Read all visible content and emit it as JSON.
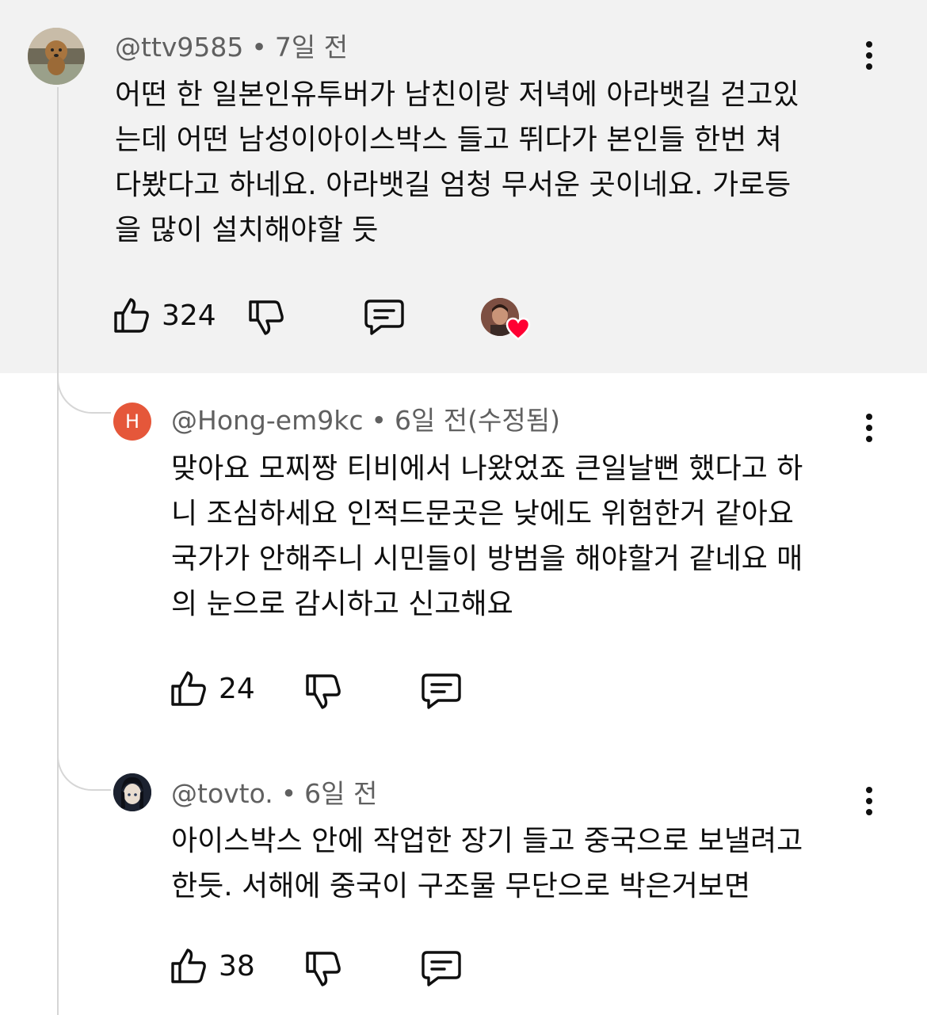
{
  "comments": [
    {
      "handle": "@ttv9585",
      "time": "7일 전",
      "text": "어떤 한 일본인유투버가 남친이랑 저녁에 아라뱃길 걷고있\n는데 어떤 남성이아이스박스 들고 뛰다가 본인들 한번 쳐\n다봤다고 하네요.  아라뱃길 엄청 무서운 곳이네요. 가로등\n을 많이 설치해야할 듯",
      "likes": "324",
      "avatar_icon": "dog-photo-avatar",
      "creator_heart_icon": "heart-icon"
    },
    {
      "handle": "@Hong-em9kc",
      "time": "6일 전(수정됨)",
      "text": "맞아요 모찌짱 티비에서 나왔었죠 큰일날뻔 했다고 하\n니 조심하세요 인적드문곳은 낮에도 위험한거 같아요\n국가가 안해주니 시민들이 방범을 해야할거 같네요 매\n의 눈으로 감시하고 신고해요",
      "likes": "24",
      "avatar_letter": "H",
      "avatar_color": "#e5573a"
    },
    {
      "handle": "@tovto.",
      "time": "6일 전",
      "text": "아이스박스 안에 작업한 장기 들고 중국으로 보낼려고\n한듯. 서해에 중국이 구조물 무단으로 박은거보면",
      "likes": "38",
      "avatar_icon": "anime-character-avatar"
    }
  ],
  "separator": "•",
  "colors": {
    "highlight_bg": "#f2f2f2",
    "meta_text": "#606060",
    "heart": "#ff0033"
  }
}
